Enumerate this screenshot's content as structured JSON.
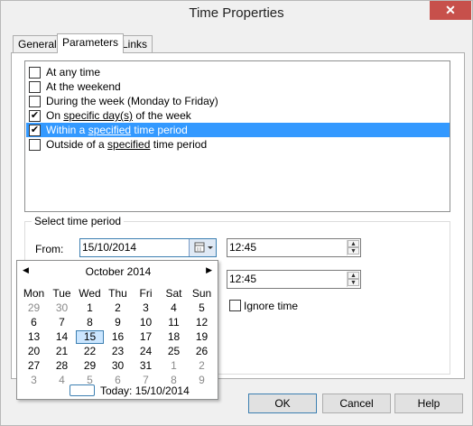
{
  "window": {
    "title": "Time Properties",
    "close_glyph": "✕"
  },
  "tabs": [
    {
      "label": "General"
    },
    {
      "label": "Parameters"
    },
    {
      "label": "Links"
    }
  ],
  "options": [
    {
      "text_before": "At any time",
      "underlined": "",
      "text_after": "",
      "checked": false,
      "selected": false
    },
    {
      "text_before": "At the weekend",
      "underlined": "",
      "text_after": "",
      "checked": false,
      "selected": false
    },
    {
      "text_before": "During the week (Monday to Friday)",
      "underlined": "",
      "text_after": "",
      "checked": false,
      "selected": false
    },
    {
      "text_before": "On ",
      "underlined": "specific day(s)",
      "text_after": " of the week",
      "checked": true,
      "selected": false
    },
    {
      "text_before": "Within a ",
      "underlined": "specified",
      "text_after": " time period",
      "checked": true,
      "selected": true
    },
    {
      "text_before": "Outside of a ",
      "underlined": "specified",
      "text_after": " time period",
      "checked": false,
      "selected": false
    }
  ],
  "period": {
    "group_label": "Select time period",
    "from_label": "From:",
    "from_date": "15/10/2014",
    "from_time": "12:45",
    "to_time": "12:45",
    "ignore_time_label": "Ignore time"
  },
  "calendar": {
    "month_label": "October 2014",
    "prev_glyph": "◀",
    "next_glyph": "▶",
    "weekdays": [
      "Mon",
      "Tue",
      "Wed",
      "Thu",
      "Fri",
      "Sat",
      "Sun"
    ],
    "weeks": [
      [
        "29",
        "30",
        "1",
        "2",
        "3",
        "4",
        "5"
      ],
      [
        "6",
        "7",
        "8",
        "9",
        "10",
        "11",
        "12"
      ],
      [
        "13",
        "14",
        "15",
        "16",
        "17",
        "18",
        "19"
      ],
      [
        "20",
        "21",
        "22",
        "23",
        "24",
        "25",
        "26"
      ],
      [
        "27",
        "28",
        "29",
        "30",
        "31",
        "1",
        "2"
      ],
      [
        "3",
        "4",
        "5",
        "6",
        "7",
        "8",
        "9"
      ]
    ],
    "today_label": "Today: 15/10/2014"
  },
  "buttons": {
    "ok": "OK",
    "cancel": "Cancel",
    "help": "Help"
  },
  "colors": {
    "selection": "#3399ff",
    "close": "#c7504b",
    "accent": "#3c7fb1"
  }
}
